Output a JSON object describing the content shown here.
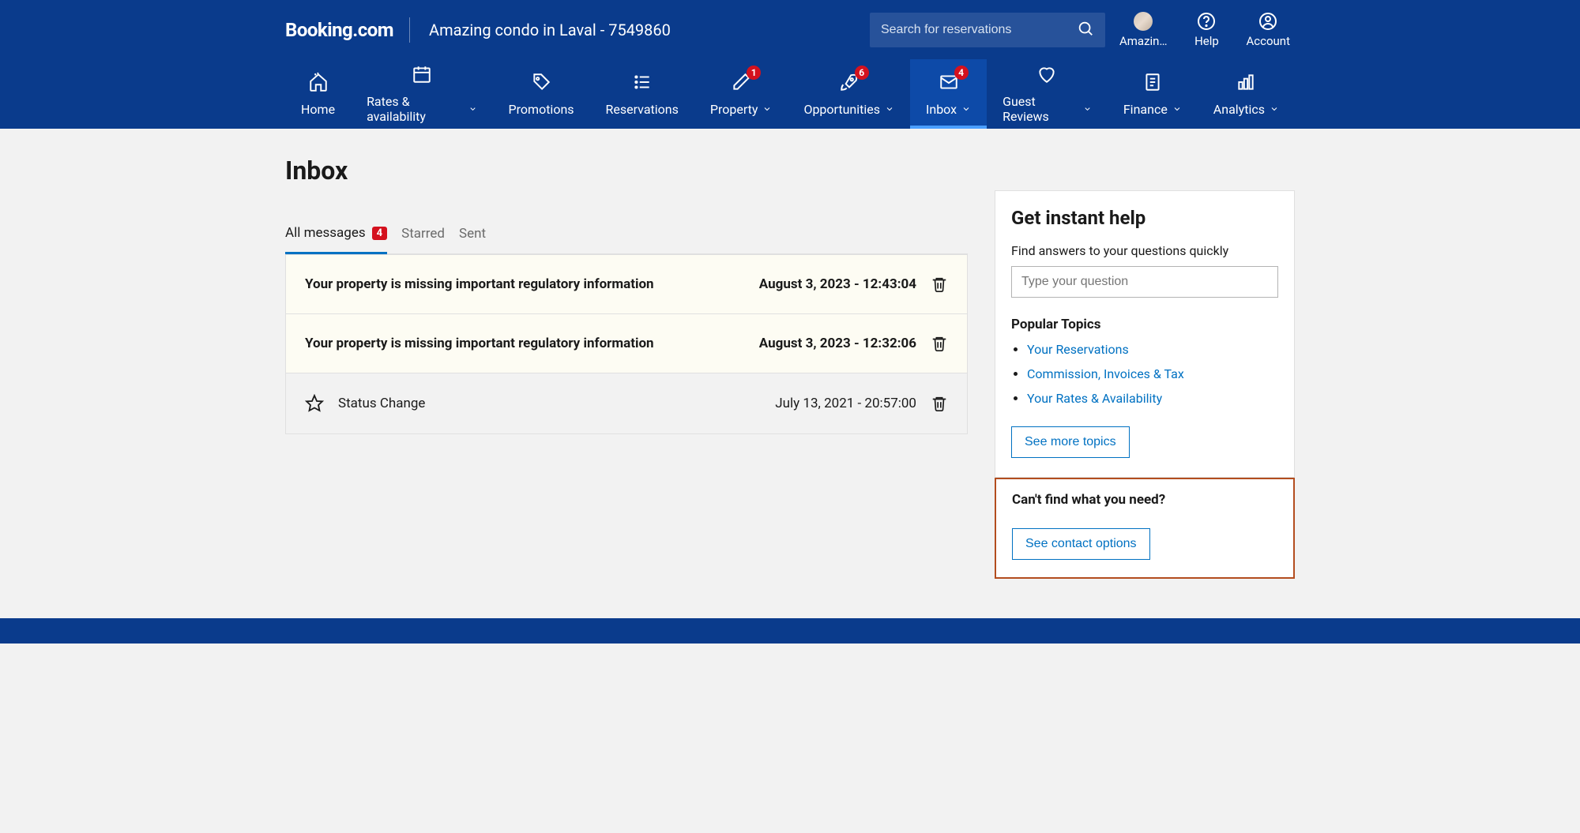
{
  "logo": "Booking.com",
  "property_name": "Amazing condo in Laval - 7549860",
  "search": {
    "placeholder": "Search for reservations"
  },
  "top_icons": {
    "user_label": "Amazin…",
    "help_label": "Help",
    "account_label": "Account"
  },
  "nav": {
    "home": "Home",
    "rates": "Rates & availability",
    "promotions": "Promotions",
    "reservations": "Reservations",
    "property": "Property",
    "opportunities": "Opportunities",
    "inbox": "Inbox",
    "guest_reviews": "Guest Reviews",
    "finance": "Finance",
    "analytics": "Analytics",
    "badges": {
      "reservations": "1",
      "opportunities": "6",
      "inbox": "4"
    }
  },
  "page_title": "Inbox",
  "tabs": {
    "all": "All messages",
    "all_count": "4",
    "starred": "Starred",
    "sent": "Sent"
  },
  "messages": [
    {
      "subject": "Your property is missing important regulatory information",
      "date": "August 3, 2023 - 12:43:04",
      "unread": true,
      "starred": false,
      "show_star": false
    },
    {
      "subject": "Your property is missing important regulatory information",
      "date": "August 3, 2023 - 12:32:06",
      "unread": true,
      "starred": false,
      "show_star": false
    },
    {
      "subject": "Status Change",
      "date": "July 13, 2021 - 20:57:00",
      "unread": false,
      "starred": false,
      "show_star": true
    }
  ],
  "help_panel": {
    "title": "Get instant help",
    "subtitle": "Find answers to your questions quickly",
    "input_placeholder": "Type your question",
    "popular_title": "Popular Topics",
    "topics": [
      "Your Reservations",
      "Commission, Invoices & Tax",
      "Your Rates & Availability"
    ],
    "see_more": "See more topics",
    "cant_find": "Can't find what you need?",
    "contact": "See contact options"
  }
}
